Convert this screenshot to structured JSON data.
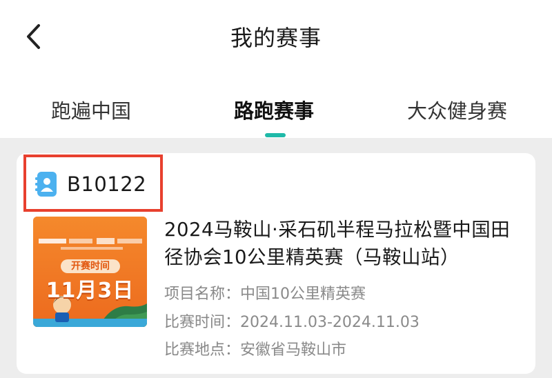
{
  "header": {
    "title": "我的赛事",
    "back_icon": "back-arrow-icon"
  },
  "tabs": [
    {
      "label": "跑遍中国",
      "active": false
    },
    {
      "label": "路跑赛事",
      "active": true
    },
    {
      "label": "大众健身赛",
      "active": false
    }
  ],
  "colors": {
    "accent": "#1fb9a8",
    "highlight": "#e8402e",
    "id_icon": "#4cb1ef",
    "poster": "#f07a26"
  },
  "event": {
    "id": "B10122",
    "id_icon": "contact-card-icon",
    "name": "2024马鞍山·采石矶半程马拉松暨中国田径协会10公里精英赛（马鞍山站）",
    "poster": {
      "date_label": "开赛时间",
      "date": "11月3日"
    },
    "fields": [
      {
        "label": "项目名称：",
        "value": "中国10公里精英赛"
      },
      {
        "label": "比赛时间：",
        "value": "2024.11.03-2024.11.03"
      },
      {
        "label": "比赛地点：",
        "value": "安徽省马鞍山市"
      }
    ]
  }
}
